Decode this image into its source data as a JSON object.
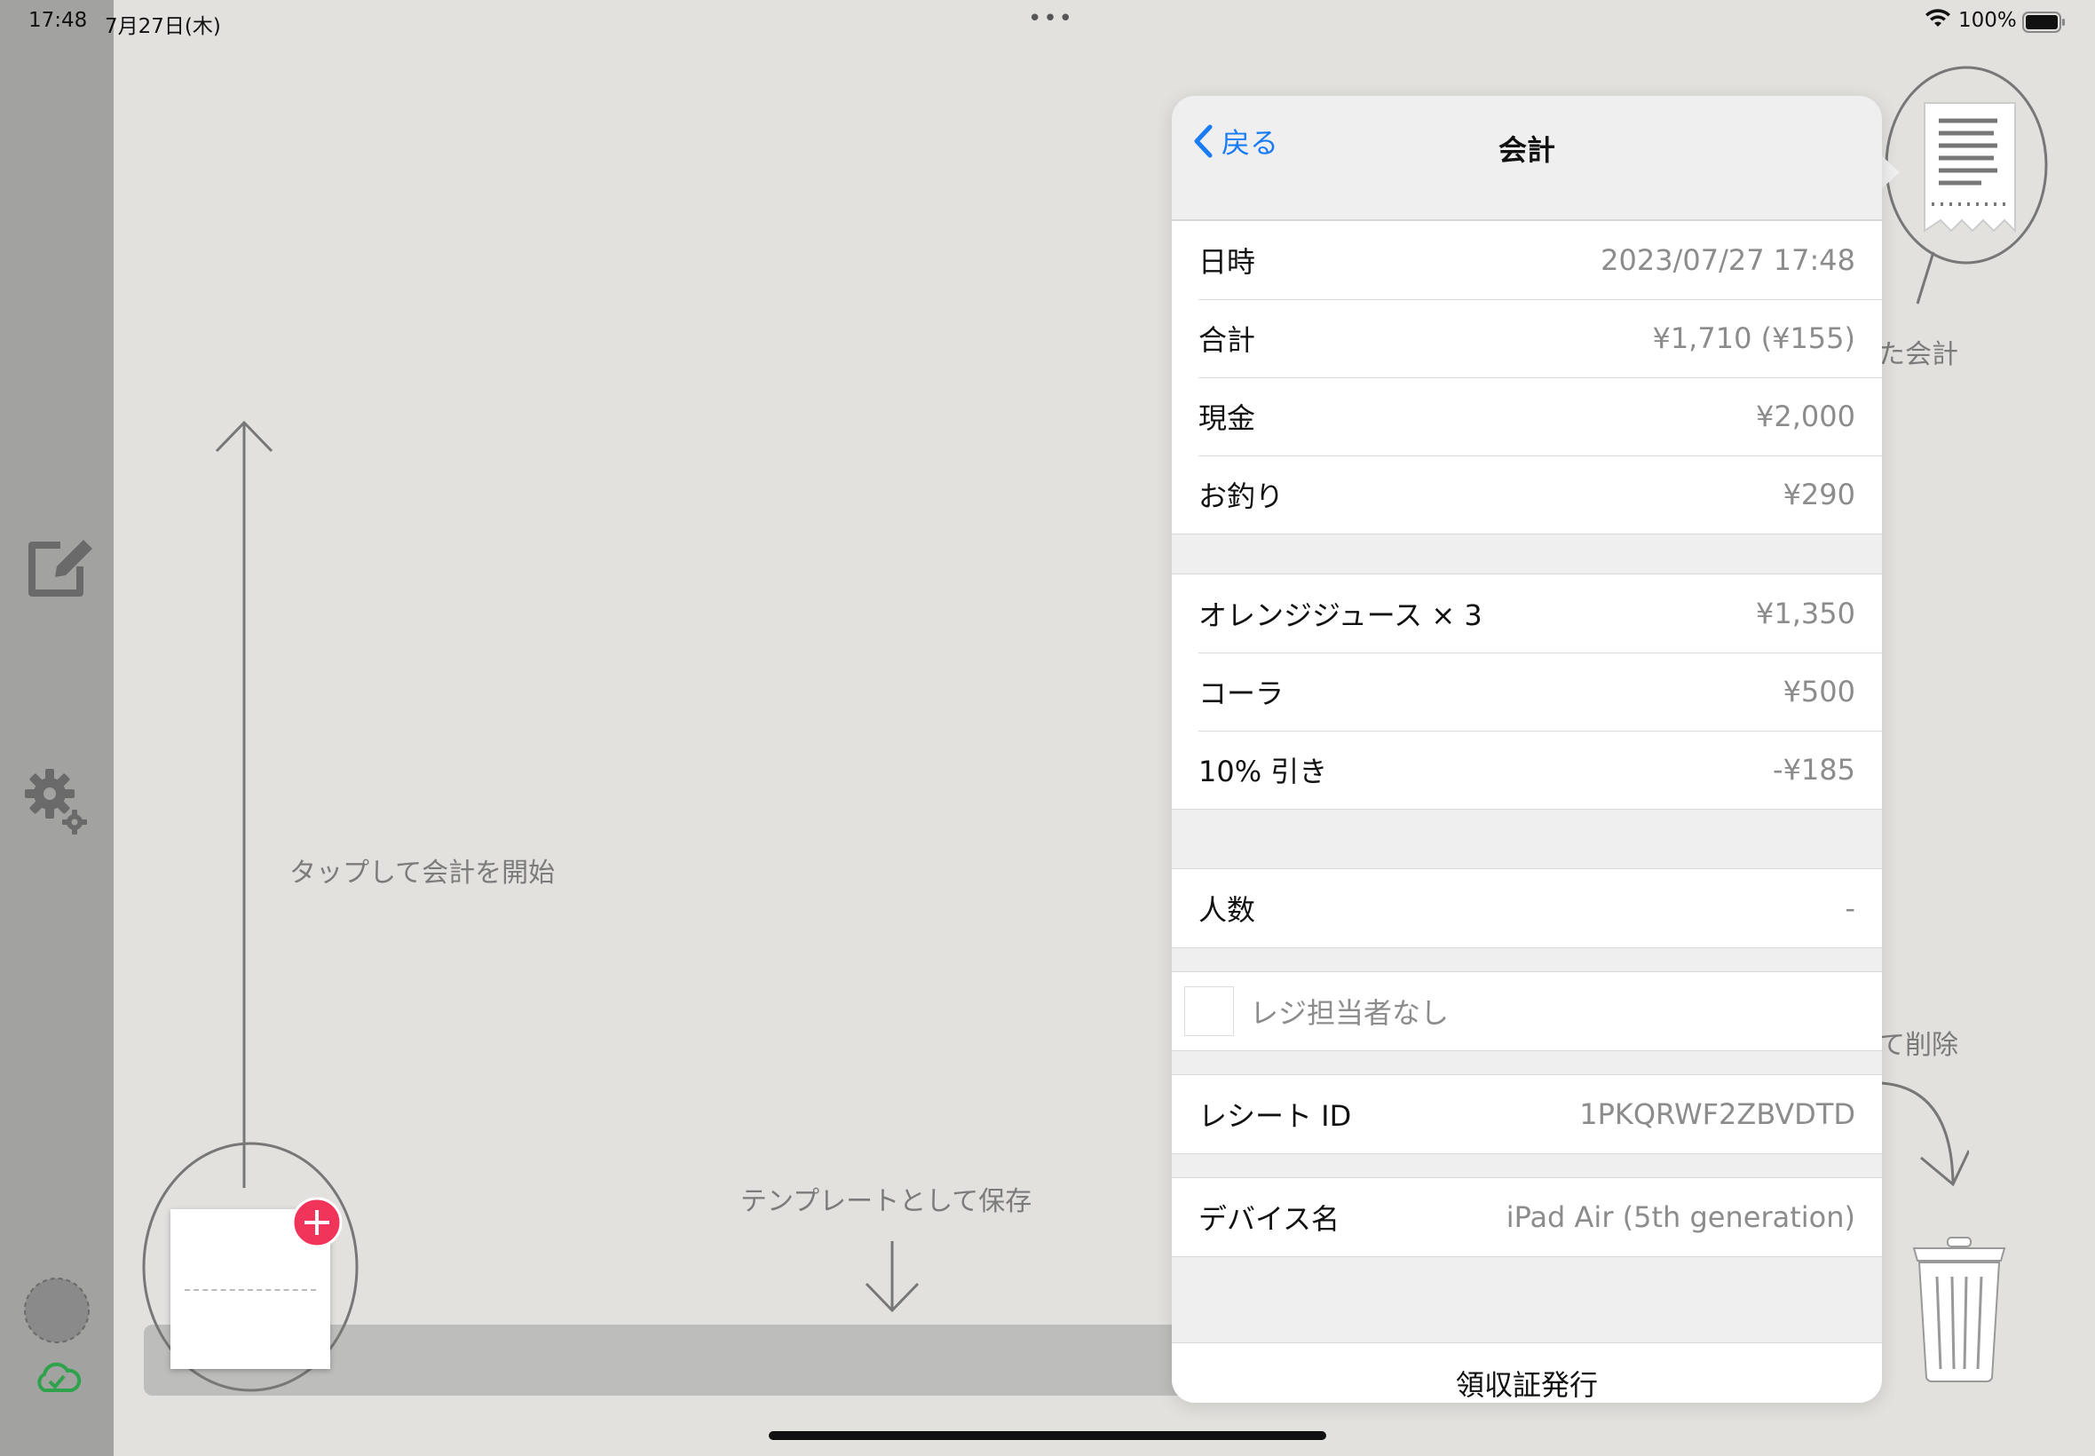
{
  "status_bar": {
    "time": "17:48",
    "date": "7月27日(木)",
    "dots": "•••",
    "battery": "100%"
  },
  "hints": {
    "tap_to_start": "タップして会計を開始",
    "save_template": "テンプレートとして保存",
    "saved_checkout": "た会計",
    "drag_delete": "て削除"
  },
  "popover": {
    "back_label": "戻る",
    "title": "会計",
    "summary": [
      {
        "label": "日時",
        "value": "2023/07/27 17:48"
      },
      {
        "label": "合計",
        "value": "¥1,710 (¥155)"
      },
      {
        "label": "現金",
        "value": "¥2,000"
      },
      {
        "label": "お釣り",
        "value": "¥290"
      }
    ],
    "items": [
      {
        "label": "オレンジジュース × 3",
        "value": "¥1,350"
      },
      {
        "label": "コーラ",
        "value": "¥500"
      },
      {
        "label": "10% 引き",
        "value": "-¥185"
      }
    ],
    "people": {
      "label": "人数",
      "value": "-"
    },
    "staff": {
      "value": "レジ担当者なし"
    },
    "receipt_id": {
      "label": "レシート ID",
      "value": "1PKQRWF2ZBVDTD"
    },
    "device": {
      "label": "デバイス名",
      "value": "iPad Air (5th generation)"
    },
    "issue_receipt": "領収証発行"
  },
  "colors": {
    "accent": "#1a7cf5",
    "add_badge": "#f0345a",
    "cloud_ok": "#2fa24c"
  }
}
